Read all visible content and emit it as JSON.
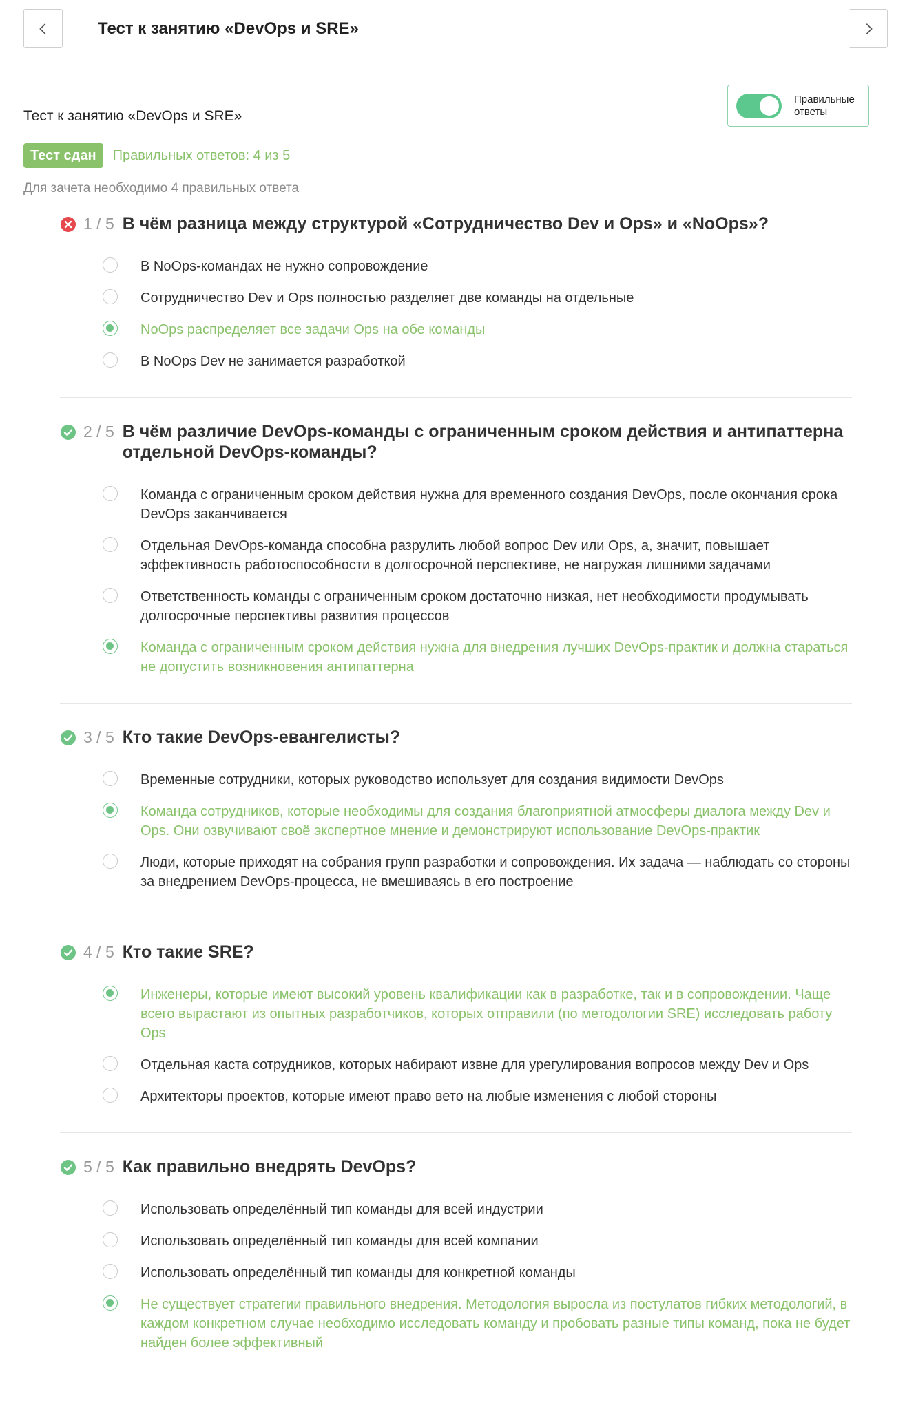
{
  "header": {
    "title": "Тест к занятию «DevOps и SRE»",
    "prev_icon": "chevron-left-icon",
    "next_icon": "chevron-right-icon"
  },
  "toggle": {
    "label": "Правильные ответы",
    "state": "on",
    "color": "#5cc88e"
  },
  "test_name": "Тест к занятию «DevOps и SRE»",
  "status_badge": "Тест сдан",
  "score_text": "Правильных ответов: 4 из 5",
  "requirement": "Для зачета необходимо 4 правильных ответа",
  "colors": {
    "correct": "#8ac26b",
    "badge": "#8ac26b",
    "wrong": "#e5484d",
    "ok_icon": "#6ec485"
  },
  "questions": [
    {
      "status": "wrong",
      "number": "1 / 5",
      "text": "В чём разница между структурой «Сотрудничество Dev и Ops» и «NoOps»?",
      "answers": [
        {
          "text": "В NoOps-командах не нужно сопровождение",
          "selected": false,
          "correct": false
        },
        {
          "text": "Сотрудничество Dev и Ops полностью разделяет две команды на отдельные",
          "selected": false,
          "correct": false
        },
        {
          "text": "NoOps распределяет все задачи Ops на обе команды",
          "selected": true,
          "correct": true
        },
        {
          "text": "В NoOps Dev не занимается разработкой",
          "selected": false,
          "correct": false
        }
      ]
    },
    {
      "status": "right",
      "number": "2 / 5",
      "text": "В чём различие DevOps-команды с ограниченным сроком действия и антипаттерна отдельной DevOps-команды?",
      "answers": [
        {
          "text": "Команда с ограниченным сроком действия нужна для временного создания DevOps, после окончания срока DevOps заканчивается",
          "selected": false,
          "correct": false
        },
        {
          "text": "Отдельная DevOps-команда способна разрулить любой вопрос Dev или Ops, а, значит, повышает эффективность работоспособности в долгосрочной перспективе, не нагружая лишними задачами",
          "selected": false,
          "correct": false
        },
        {
          "text": "Ответственность команды с ограниченным сроком достаточно низкая, нет необходимости продумывать долгосрочные перспективы развития процессов",
          "selected": false,
          "correct": false
        },
        {
          "text": "Команда с ограниченным сроком действия нужна для внедрения лучших DevOps-практик и должна стараться не допустить возникновения антипаттерна",
          "selected": true,
          "correct": true
        }
      ]
    },
    {
      "status": "right",
      "number": "3 / 5",
      "text": "Кто такие DevOps-евангелисты?",
      "answers": [
        {
          "text": "Временные сотрудники, которых руководство использует для создания видимости DevOps",
          "selected": false,
          "correct": false
        },
        {
          "text": "Команда сотрудников, которые необходимы для создания благоприятной атмосферы диалога между Dev и Ops. Они озвучивают своё экспертное мнение и демонстрируют использование DevOps-практик",
          "selected": true,
          "correct": true
        },
        {
          "text": "Люди, которые приходят на собрания групп разработки и сопровождения. Их задача — наблюдать со стороны за внедрением DevOps-процесса, не вмешиваясь в его построение",
          "selected": false,
          "correct": false
        }
      ]
    },
    {
      "status": "right",
      "number": "4 / 5",
      "text": "Кто такие SRE?",
      "answers": [
        {
          "text": "Инженеры, которые имеют высокий уровень квалификации как в разработке, так и в сопровождении. Чаще всего вырастают из опытных разработчиков, которых отправили (по методологии SRE) исследовать работу Ops",
          "selected": true,
          "correct": true
        },
        {
          "text": "Отдельная каста сотрудников, которых набирают извне для урегулирования вопросов между Dev и Ops",
          "selected": false,
          "correct": false
        },
        {
          "text": "Архитекторы проектов, которые имеют право вето на любые изменения с любой стороны",
          "selected": false,
          "correct": false
        }
      ]
    },
    {
      "status": "right",
      "number": "5 / 5",
      "text": "Как правильно внедрять DevOps?",
      "answers": [
        {
          "text": "Использовать определённый тип команды для всей индустрии",
          "selected": false,
          "correct": false
        },
        {
          "text": "Использовать определённый тип команды для всей компании",
          "selected": false,
          "correct": false
        },
        {
          "text": "Использовать определённый тип команды для конкретной команды",
          "selected": false,
          "correct": false
        },
        {
          "text": "Не существует стратегии правильного внедрения. Методология выросла из постулатов гибких методологий, в каждом конкретном случае необходимо исследовать команду и пробовать разные типы команд, пока не будет найден более эффективный",
          "selected": true,
          "correct": true
        }
      ]
    }
  ]
}
